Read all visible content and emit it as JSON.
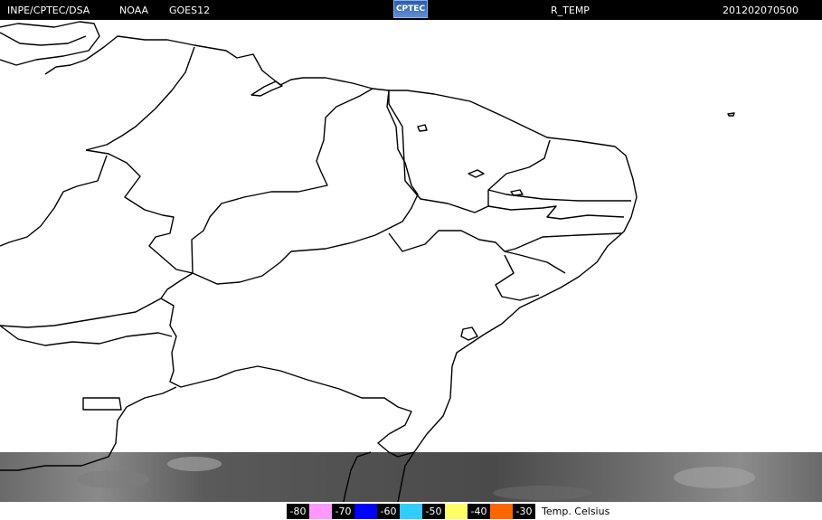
{
  "header": {
    "org": "INPE/CPTEC/DSA",
    "agency": "NOAA",
    "satellite": "GOES12",
    "logo_text": "CPTEC",
    "product": "R_TEMP",
    "timestamp": "201202070500"
  },
  "legend": {
    "items": [
      {
        "label": "-80",
        "color": "#000000",
        "text_color": "#ffffff"
      },
      {
        "label": "",
        "color": "#ff99ff",
        "text_color": "#000000"
      },
      {
        "label": "-70",
        "color": "#000000",
        "text_color": "#ffffff"
      },
      {
        "label": "",
        "color": "#0000ff",
        "text_color": "#000000"
      },
      {
        "label": "-60",
        "color": "#000000",
        "text_color": "#ffffff"
      },
      {
        "label": "",
        "color": "#33ccff",
        "text_color": "#000000"
      },
      {
        "label": "-50",
        "color": "#000000",
        "text_color": "#ffffff"
      },
      {
        "label": "",
        "color": "#ffff66",
        "text_color": "#000000"
      },
      {
        "label": "-40",
        "color": "#000000",
        "text_color": "#ffffff"
      },
      {
        "label": "",
        "color": "#ff6600",
        "text_color": "#000000"
      },
      {
        "label": "-30",
        "color": "#000000",
        "text_color": "#ffffff"
      }
    ],
    "unit_label": "Temp. Celsius"
  },
  "colors": {
    "background": "#ffffff",
    "boundary": "#000000",
    "cloud_band": "#555555"
  }
}
